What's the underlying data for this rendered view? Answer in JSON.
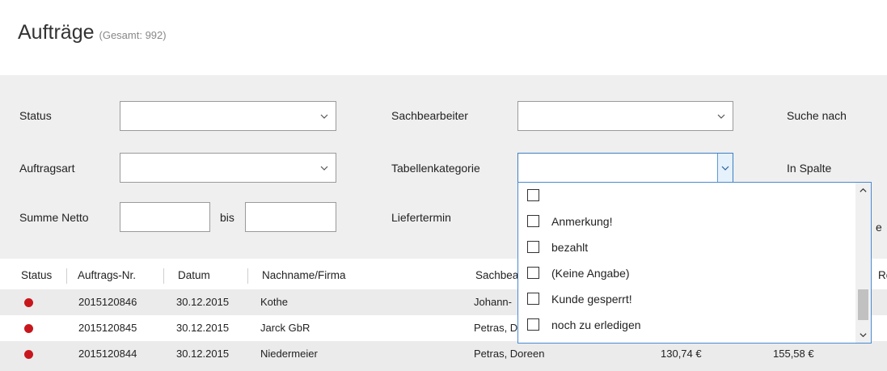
{
  "page": {
    "title": "Aufträge",
    "total": "(Gesamt: 992)"
  },
  "filters": {
    "status_label": "Status",
    "auftragsart_label": "Auftragsart",
    "summe_netto_label": "Summe Netto",
    "bis_label": "bis",
    "sachbearbeiter_label": "Sachbearbeiter",
    "tabellenkategorie_label": "Tabellenkategorie",
    "liefertermin_label": "Liefertermin",
    "suche_nach_label": "Suche nach",
    "in_spalte_label": "In Spalte",
    "status_value": "",
    "auftragsart_value": "",
    "sachbearbeiter_value": "",
    "tabellenkategorie_value": "",
    "summe_von_value": "",
    "summe_bis_value": "",
    "partial_label": "e"
  },
  "dropdown": {
    "options": [
      "",
      "Anmerkung!",
      "bezahlt",
      "(Keine Angabe)",
      "Kunde gesperrt!",
      "noch zu erledigen"
    ]
  },
  "table": {
    "headers": [
      "Status",
      "Auftrags-Nr.",
      "Datum",
      "Nachname/Firma",
      "Sachbea",
      "Ro"
    ],
    "rows": [
      {
        "status_color": "#c8161d",
        "nr": "2015120846",
        "datum": "30.12.2015",
        "name": "Kothe",
        "sachbearbeiter": "Johann-",
        "netto": "",
        "brutto": ""
      },
      {
        "status_color": "#c8161d",
        "nr": "2015120845",
        "datum": "30.12.2015",
        "name": "Jarck GbR",
        "sachbearbeiter": "Petras, D",
        "netto": "",
        "brutto": ""
      },
      {
        "status_color": "#c8161d",
        "nr": "2015120844",
        "datum": "30.12.2015",
        "name": "Niedermeier",
        "sachbearbeiter": "Petras, Doreen",
        "netto": "130,74 €",
        "brutto": "155,58 €"
      }
    ]
  },
  "colors": {
    "status_red": "#c8161d",
    "accent_blue": "#3c7fc1",
    "panel_gray": "#efefef"
  },
  "icons": {
    "chevron": "chevron-down-icon",
    "scroll_up": "chevron-up-icon",
    "scroll_down": "chevron-down-icon"
  }
}
